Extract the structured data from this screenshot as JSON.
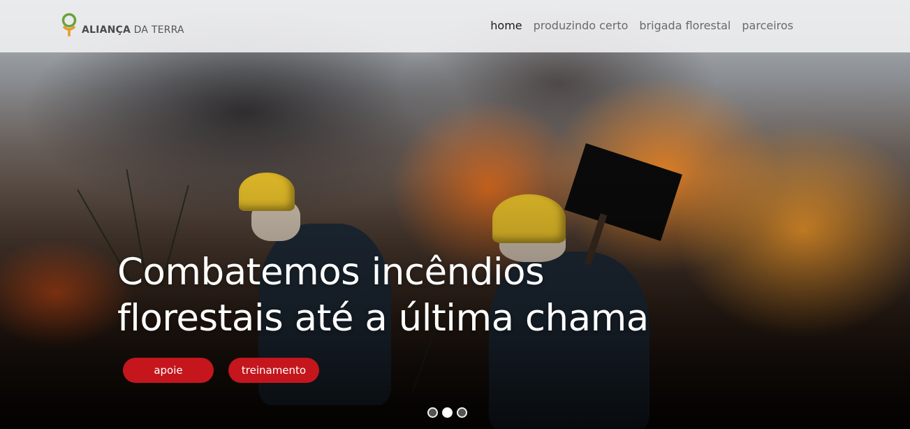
{
  "header": {
    "logo": {
      "icon": "tree-leaf-logo-icon",
      "text_strong": "ALIANÇA",
      "text_light": " DA TERRA"
    },
    "nav": [
      {
        "label": "home",
        "active": true
      },
      {
        "label": "produzindo certo",
        "active": false
      },
      {
        "label": "brigada florestal",
        "active": false
      },
      {
        "label": "parceiros",
        "active": false
      }
    ]
  },
  "hero": {
    "headline_line1": "Combatemos incêndios",
    "headline_line2": "florestais até a última chama",
    "buttons": {
      "apoie": "apoie",
      "treinamento": "treinamento"
    },
    "carousel": {
      "slides": 3,
      "active_index": 1
    }
  },
  "colors": {
    "accent_red": "#c4161c",
    "logo_green": "#6aa23a",
    "logo_orange": "#e99a2b",
    "nav_bg": "#f0f0f2"
  }
}
